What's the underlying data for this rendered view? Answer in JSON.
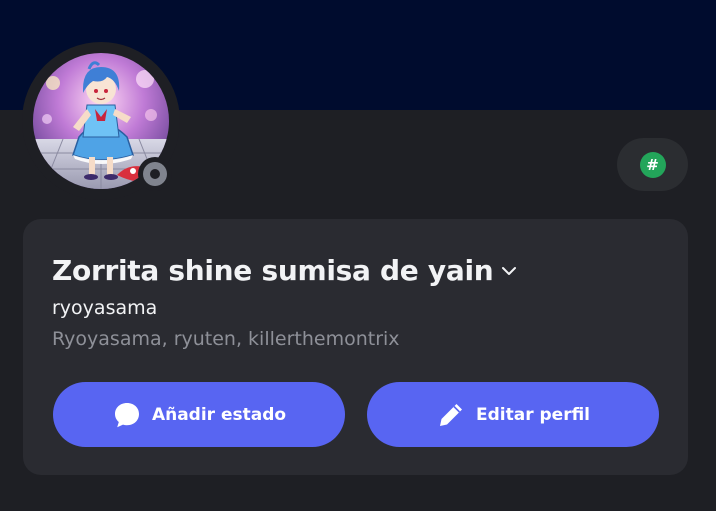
{
  "profile": {
    "display_name": "Zorrita shine sumisa de yain",
    "username": "ryoyasama",
    "pronouns": "Ryoyasama, ryuten, killerthemontrix",
    "status": "offline"
  },
  "nitro_badge": {
    "symbol": "#"
  },
  "actions": {
    "add_status_label": "Añadir estado",
    "edit_profile_label": "Editar perfil"
  },
  "colors": {
    "banner": "#000c2e",
    "background": "#1e1f24",
    "card": "#2a2b31",
    "accent": "#5865f2",
    "badge": "#23a55a",
    "status_offline": "#80848e"
  },
  "icons": {
    "add_status": "speech-bubble-icon",
    "edit_profile": "pencil-icon",
    "dropdown": "chevron-down-icon"
  }
}
